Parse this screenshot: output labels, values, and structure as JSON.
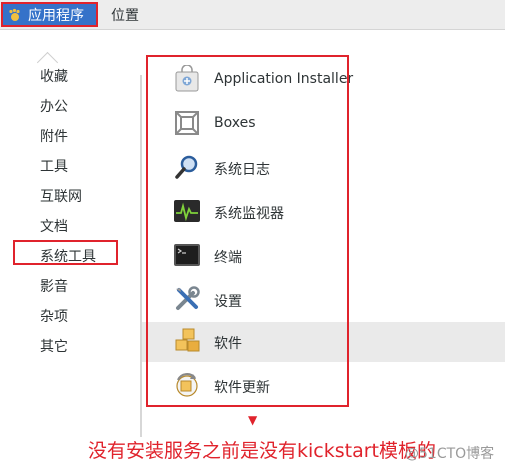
{
  "topbar": {
    "applications_label": "应用程序",
    "places_label": "位置"
  },
  "categories": [
    {
      "label": "收藏"
    },
    {
      "label": "办公"
    },
    {
      "label": "附件"
    },
    {
      "label": "工具"
    },
    {
      "label": "互联网"
    },
    {
      "label": "文档"
    },
    {
      "label": "系统工具"
    },
    {
      "label": "影音"
    },
    {
      "label": "杂项"
    },
    {
      "label": "其它"
    }
  ],
  "apps": [
    {
      "name": "Application Installer",
      "icon": "bag-icon"
    },
    {
      "name": "Boxes",
      "icon": "boxes-icon"
    },
    {
      "name": "系统日志",
      "icon": "magnifier-icon"
    },
    {
      "name": "系统监视器",
      "icon": "monitor-icon"
    },
    {
      "name": "终端",
      "icon": "terminal-icon"
    },
    {
      "name": "设置",
      "icon": "tools-icon"
    },
    {
      "name": "软件",
      "icon": "packages-icon"
    },
    {
      "name": "软件更新",
      "icon": "update-icon"
    }
  ],
  "annotation": {
    "arrow": "▼",
    "text": "没有安装服务之前是没有kickstart模板的"
  },
  "watermark": "@51CTO博客",
  "colors": {
    "highlight_red": "#e0232c",
    "apps_button_blue": "#3572c9"
  }
}
